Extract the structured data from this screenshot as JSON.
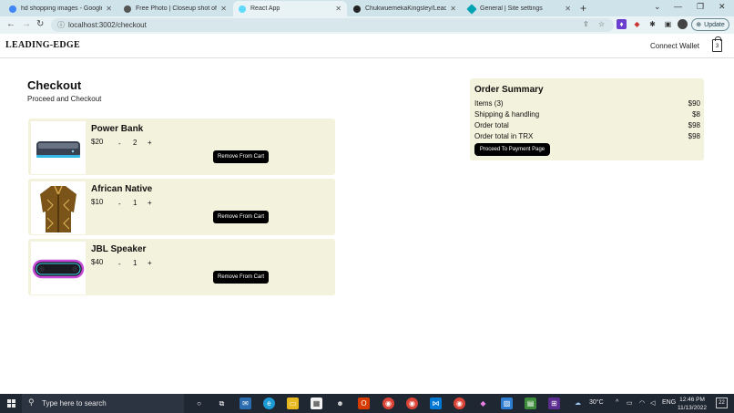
{
  "browser": {
    "tabs": [
      {
        "label": "hd shopping images - Google Se",
        "color": "#4285f4"
      },
      {
        "label": "Free Photo | Closeup shot of two",
        "color": "#333333"
      },
      {
        "label": "React App",
        "color": "#61dafb"
      },
      {
        "label": "ChukwuemekaKingsley/LeadingE",
        "color": "#222222"
      },
      {
        "label": "General | Site settings",
        "color": "#00a3b4"
      }
    ],
    "url": "localhost:3002/checkout",
    "update_label": "Update"
  },
  "app": {
    "brand": "LEADING-EDGE",
    "connect_wallet": "Connect Wallet",
    "cart_count": "3"
  },
  "checkout": {
    "title": "Checkout",
    "subtitle": "Proceed and Checkout",
    "items": [
      {
        "name": "Power Bank",
        "price": "$20",
        "qty": "2",
        "minus": "-",
        "plus": "+",
        "remove_label": "Remove From Cart"
      },
      {
        "name": "African Native",
        "price": "$10",
        "qty": "1",
        "minus": "-",
        "plus": "+",
        "remove_label": "Remove From Cart"
      },
      {
        "name": "JBL Speaker",
        "price": "$40",
        "qty": "1",
        "minus": "-",
        "plus": "+",
        "remove_label": "Remove From Cart"
      }
    ]
  },
  "summary": {
    "title": "Order Summary",
    "rows": [
      {
        "label": "Items (3)",
        "value": "$90"
      },
      {
        "label": "Shipping & handling",
        "value": "$8"
      },
      {
        "label": "Order total",
        "value": "$98"
      },
      {
        "label": "Order total in TRX",
        "value": "$98"
      }
    ],
    "pay_label": "Proceed To Payment Page"
  },
  "taskbar": {
    "search_placeholder": "Type here to search",
    "weather": "30°C",
    "language": "ENG",
    "time": "12:46 PM",
    "date": "11/13/2022",
    "notifications": "22"
  }
}
